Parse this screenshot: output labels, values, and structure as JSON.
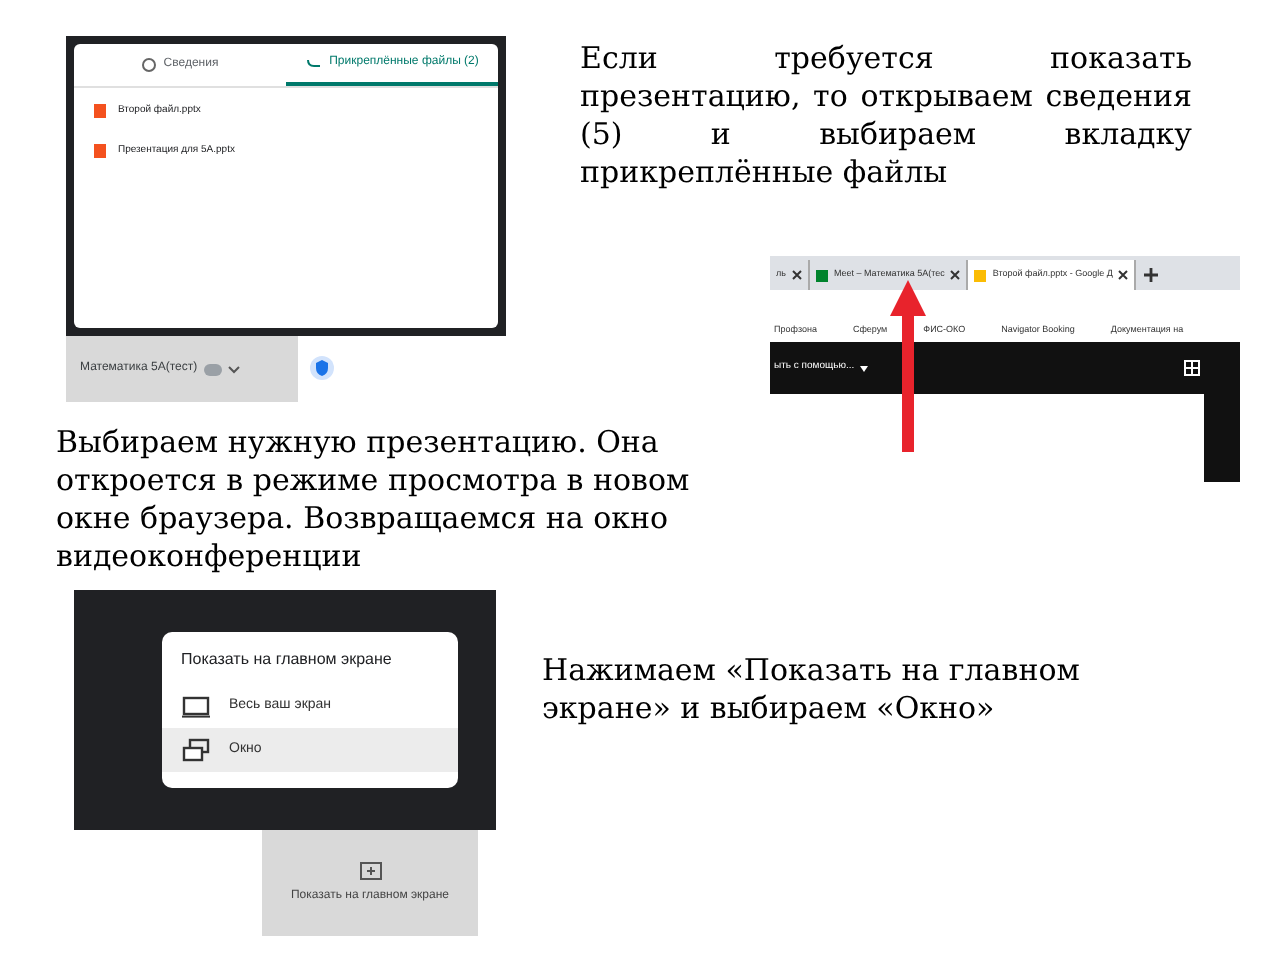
{
  "step_1": {
    "text": "Если требуется показать презентацию, то открываем сведения (5) и выбираем вкладку прикреплённые файлы",
    "tabs": [
      {
        "label": "Сведения",
        "selected": false
      },
      {
        "label": "Прикреплённые файлы (2)",
        "selected": true
      }
    ],
    "files": [
      "Второй файл.pptx",
      "Презентация для 5А.pptx"
    ],
    "meeting_title": "Математика 5А(тест)"
  },
  "step_2": {
    "text": "Выбираем нужную презентацию. Она откроется в режиме просмотра в новом окне браузера. Возвращаемся на окно видеоконференции",
    "browser_tabs": [
      {
        "label": "ль",
        "selected": false
      },
      {
        "label": "Meet – Математика 5А(тес",
        "selected": false
      },
      {
        "label": "Второй файл.pptx - Google Д",
        "selected": true
      }
    ],
    "bookmarks": [
      "Профзона",
      "Сферум",
      "ФИС-ОКО",
      "Navigator Booking",
      "Документация на"
    ],
    "open_with": "ыть с помощью..."
  },
  "step_3": {
    "text": "Нажимаем «Показать на главном экране» и выбираем «Окно»",
    "menu_title": "Показать на главном экране",
    "options": [
      {
        "label": "Весь ваш экран",
        "kind": "screen",
        "selected": false
      },
      {
        "label": "Окно",
        "kind": "window",
        "selected": true
      }
    ],
    "button": "Показать на главном экране"
  }
}
